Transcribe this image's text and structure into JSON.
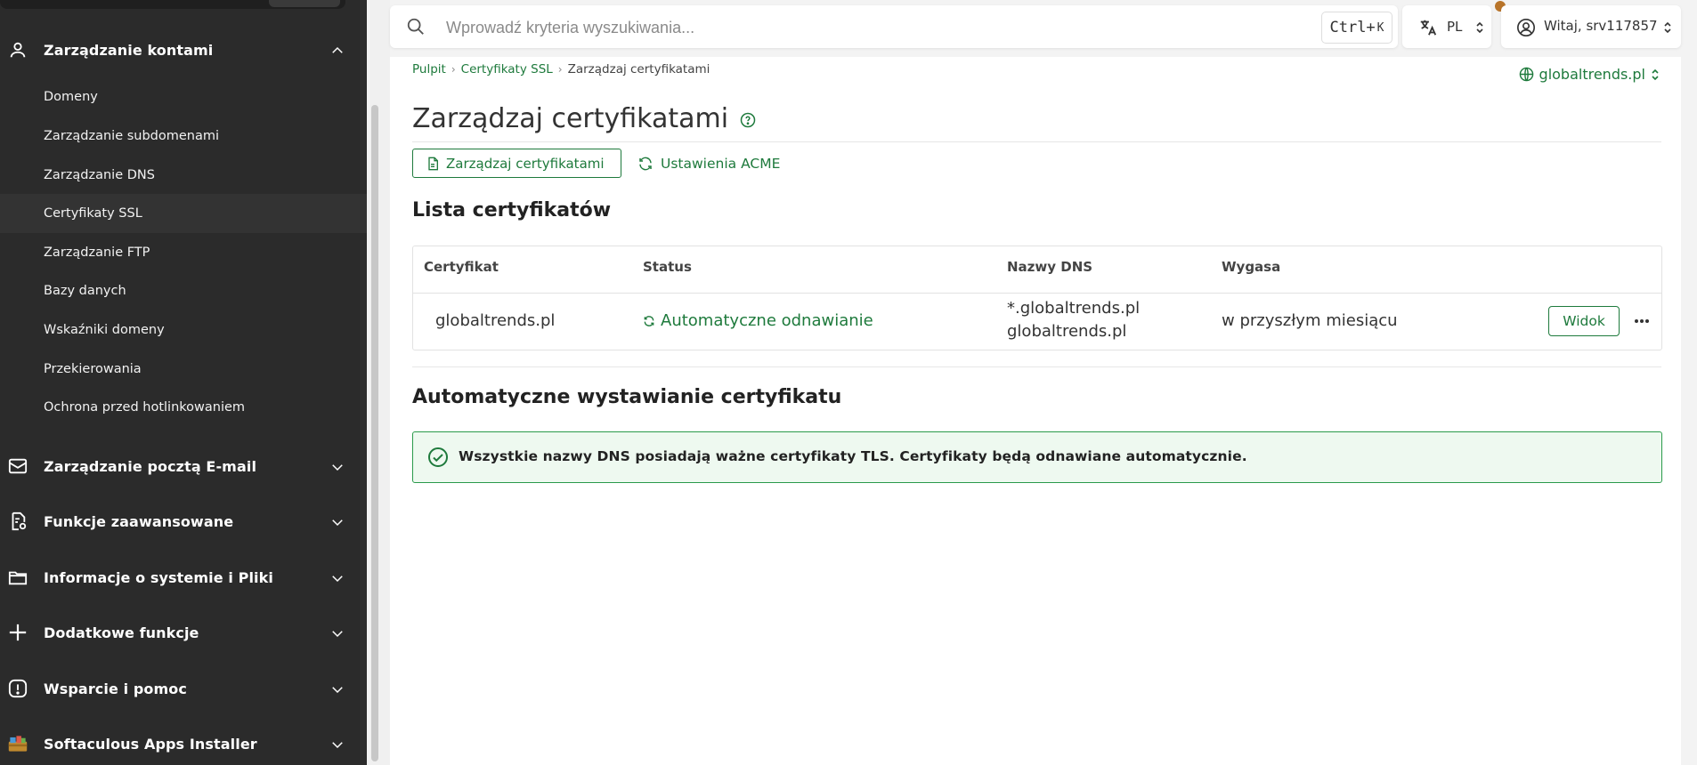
{
  "sidebar": {
    "sections": {
      "accounts": {
        "label": "Zarządzanie kontami",
        "icon": "user-icon",
        "expanded": true
      },
      "email": {
        "label": "Zarządzanie pocztą E-mail",
        "icon": "mail-icon"
      },
      "advanced": {
        "label": "Funkcje zaawansowane",
        "icon": "document-gear-icon"
      },
      "system": {
        "label": "Informacje o systemie i Pliki",
        "icon": "folder-icon"
      },
      "extra": {
        "label": "Dodatkowe funkcje",
        "icon": "plus-icon"
      },
      "support": {
        "label": "Wsparcie i pomoc",
        "icon": "alert-icon"
      },
      "softaculous": {
        "label": "Softaculous Apps Installer",
        "icon": "softaculous-icon"
      }
    },
    "items": [
      {
        "label": "Domeny"
      },
      {
        "label": "Zarządzanie subdomenami"
      },
      {
        "label": "Zarządzanie DNS"
      },
      {
        "label": "Certyfikaty SSL",
        "active": true
      },
      {
        "label": "Zarządzanie FTP"
      },
      {
        "label": "Bazy danych"
      },
      {
        "label": "Wskaźniki domeny"
      },
      {
        "label": "Przekierowania"
      },
      {
        "label": "Ochrona przed hotlinkowaniem"
      }
    ]
  },
  "topbar": {
    "search_placeholder": "Wprowadź kryteria wyszukiwania...",
    "shortcut_main": "Ctrl+",
    "shortcut_key": "K",
    "language": "PL",
    "user_greeting": "Witaj, srv117857"
  },
  "breadcrumb": {
    "home": "Pulpit",
    "parent": "Certyfikaty SSL",
    "current": "Zarządzaj certyfikatami"
  },
  "domain_selector": "globaltrends.pl",
  "page": {
    "title": "Zarządzaj certyfikatami",
    "manage_button": "Zarządzaj certyfikatami",
    "acme_button": "Ustawienia ACME",
    "list_heading": "Lista certyfikatów",
    "auto_heading": "Automatyczne wystawianie certyfikatu",
    "alert_text": "Wszystkie nazwy DNS posiadają ważne certyfikaty TLS. Certyfikaty będą odnawiane automatycznie."
  },
  "table": {
    "headers": [
      "Certyfikat",
      "Status",
      "Nazwy DNS",
      "Wygasa"
    ],
    "rows": [
      {
        "certificate": "globaltrends.pl",
        "status": "Automatyczne odnawianie",
        "dns": [
          "*.globaltrends.pl",
          "globaltrends.pl"
        ],
        "expires": "w przyszłym miesiącu",
        "view_label": "Widok"
      }
    ]
  },
  "colors": {
    "accent": "#1e7a3c",
    "sidebar_bg": "#2b2b2b",
    "notification": "#b8742a"
  }
}
